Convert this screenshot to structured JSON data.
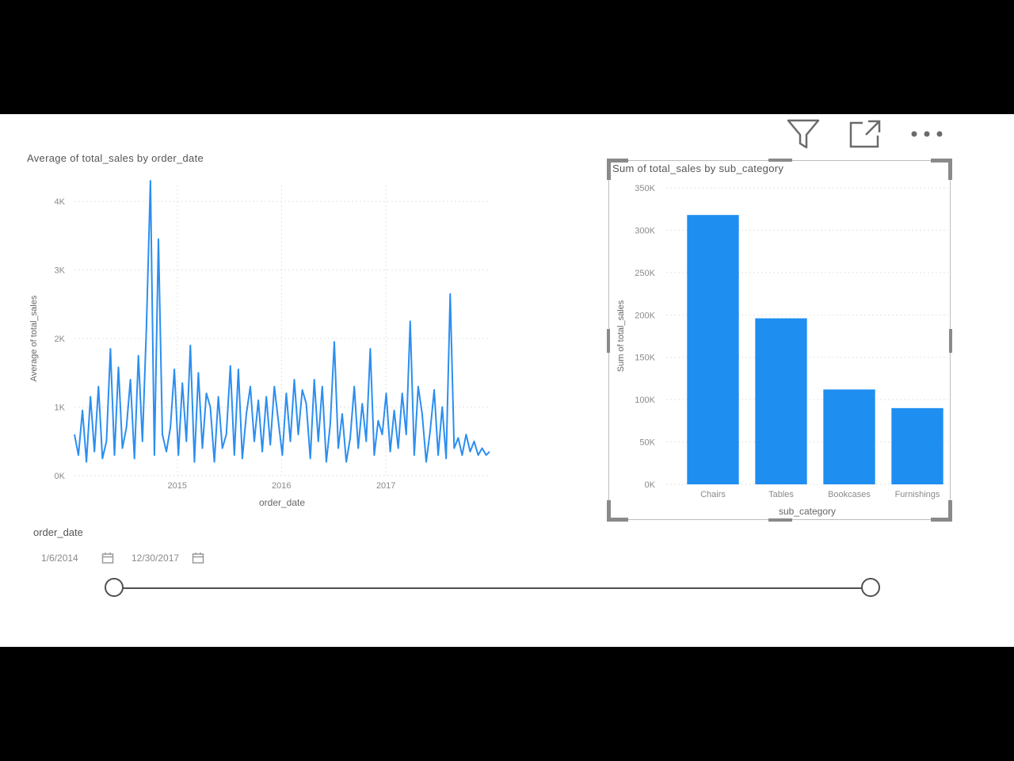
{
  "toolbar": {
    "filter_icon": "filter-icon",
    "focus_icon": "focus-mode-icon",
    "more_icon": "more-options-icon"
  },
  "line_visual": {
    "title": "Average of total_sales by order_date"
  },
  "bar_visual": {
    "title": "Sum of total_sales by sub_category"
  },
  "slicer": {
    "label": "order_date",
    "start_date": "1/6/2014",
    "end_date": "12/30/2017",
    "range_start": 0,
    "range_end": 1
  },
  "colors": {
    "series": "#2b8ef0",
    "bars": "#1f8ef1",
    "grid": "#e3e3e3",
    "axis_text": "#8a8a8a"
  },
  "chart_data": [
    {
      "type": "line",
      "title": "Average of total_sales by order_date",
      "xlabel": "order_date",
      "ylabel": "Average of total_sales",
      "x_ticks": [
        "2015",
        "2016",
        "2017"
      ],
      "y_ticks": [
        "0K",
        "1K",
        "2K",
        "3K",
        "4K"
      ],
      "ylim": [
        0,
        4000
      ],
      "xlim": [
        "2014-01-06",
        "2017-12-30"
      ],
      "grid": true,
      "series": [
        {
          "x": [
            "2014-01-06",
            "2014-01-20",
            "2014-02-03",
            "2014-02-17",
            "2014-03-03",
            "2014-03-17",
            "2014-03-31",
            "2014-04-14",
            "2014-04-28",
            "2014-05-12",
            "2014-05-26",
            "2014-06-09",
            "2014-06-23",
            "2014-07-07",
            "2014-07-21",
            "2014-08-04",
            "2014-08-18",
            "2014-09-01",
            "2014-09-15",
            "2014-09-29",
            "2014-10-13",
            "2014-10-27",
            "2014-11-10",
            "2014-11-24",
            "2014-12-08",
            "2014-12-22",
            "2015-01-05",
            "2015-01-19",
            "2015-02-02",
            "2015-02-16",
            "2015-03-02",
            "2015-03-16",
            "2015-03-30",
            "2015-04-13",
            "2015-04-27",
            "2015-05-11",
            "2015-05-25",
            "2015-06-08",
            "2015-06-22",
            "2015-07-06",
            "2015-07-20",
            "2015-08-03",
            "2015-08-17",
            "2015-08-31",
            "2015-09-14",
            "2015-09-28",
            "2015-10-12",
            "2015-10-26",
            "2015-11-09",
            "2015-11-23",
            "2015-12-07",
            "2015-12-21",
            "2016-01-04",
            "2016-01-18",
            "2016-02-01",
            "2016-02-15",
            "2016-02-29",
            "2016-03-14",
            "2016-03-28",
            "2016-04-11",
            "2016-04-25",
            "2016-05-09",
            "2016-05-23",
            "2016-06-06",
            "2016-06-20",
            "2016-07-04",
            "2016-07-18",
            "2016-08-01",
            "2016-08-15",
            "2016-08-29",
            "2016-09-12",
            "2016-09-26",
            "2016-10-10",
            "2016-10-24",
            "2016-11-07",
            "2016-11-21",
            "2016-12-05",
            "2016-12-19",
            "2017-01-02",
            "2017-01-16",
            "2017-01-30",
            "2017-02-13",
            "2017-02-27",
            "2017-03-13",
            "2017-03-27",
            "2017-04-10",
            "2017-04-24",
            "2017-05-08",
            "2017-05-22",
            "2017-06-05",
            "2017-06-19",
            "2017-07-03",
            "2017-07-17",
            "2017-07-31",
            "2017-08-14",
            "2017-08-28",
            "2017-09-11",
            "2017-09-25",
            "2017-10-09",
            "2017-10-23",
            "2017-11-06",
            "2017-11-20",
            "2017-12-04",
            "2017-12-18",
            "2017-12-30"
          ],
          "y": [
            600,
            300,
            950,
            200,
            1150,
            350,
            1300,
            250,
            500,
            1850,
            300,
            1580,
            400,
            700,
            1400,
            250,
            1750,
            500,
            2150,
            4300,
            300,
            3450,
            600,
            350,
            700,
            1550,
            300,
            1350,
            500,
            1900,
            200,
            1500,
            400,
            1200,
            1000,
            200,
            1150,
            400,
            600,
            1600,
            300,
            1550,
            250,
            900,
            1300,
            500,
            1100,
            350,
            1150,
            450,
            1300,
            800,
            300,
            1200,
            500,
            1400,
            600,
            1250,
            1050,
            250,
            1400,
            500,
            1300,
            200,
            750,
            1950,
            400,
            900,
            200,
            550,
            1300,
            400,
            1050,
            500,
            1850,
            300,
            800,
            600,
            1200,
            350,
            950,
            400,
            1200,
            600,
            2250,
            300,
            1300,
            900,
            200,
            650,
            1250,
            300,
            1000,
            250,
            2650,
            400,
            550,
            300,
            600,
            350,
            500,
            300,
            400,
            300,
            350
          ]
        }
      ]
    },
    {
      "type": "bar",
      "title": "Sum of total_sales by sub_category",
      "xlabel": "sub_category",
      "ylabel": "Sum of total_sales",
      "categories": [
        "Chairs",
        "Tables",
        "Bookcases",
        "Furnishings"
      ],
      "values": [
        318000,
        196000,
        112000,
        90000
      ],
      "y_ticks": [
        "0K",
        "50K",
        "100K",
        "150K",
        "200K",
        "250K",
        "300K",
        "350K"
      ],
      "ylim": [
        0,
        350000
      ],
      "grid": true
    }
  ]
}
